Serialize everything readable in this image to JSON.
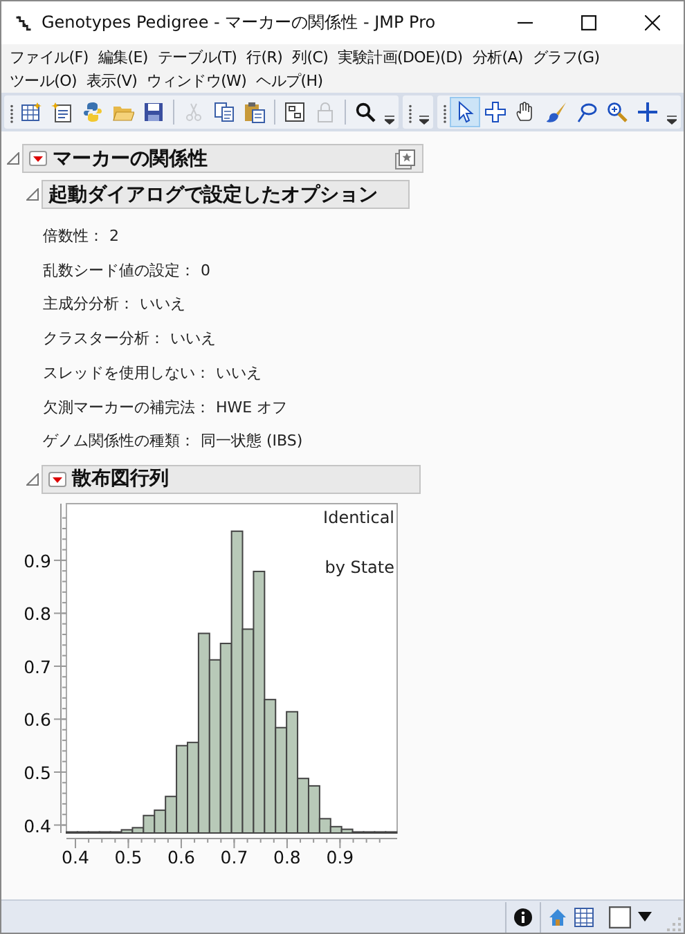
{
  "window": {
    "title": "Genotypes Pedigree - マーカーの関係性 - JMP Pro"
  },
  "menu": [
    "ファイル(F)",
    "編集(E)",
    "テーブル(T)",
    "行(R)",
    "列(C)",
    "実験計画(DOE)(D)",
    "分析(A)",
    "グラフ(G)",
    "ツール(O)",
    "表示(V)",
    "ウィンドウ(W)",
    "ヘルプ(H)"
  ],
  "toolbar": {
    "file_tools": [
      {
        "kind": "new-table",
        "disabled": false
      },
      {
        "kind": "new-script",
        "disabled": false
      },
      {
        "kind": "python",
        "disabled": false
      },
      {
        "kind": "open",
        "disabled": false
      },
      {
        "kind": "save",
        "disabled": false
      },
      {
        "kind": "cut",
        "disabled": true
      },
      {
        "kind": "copy",
        "disabled": false
      },
      {
        "kind": "paste",
        "disabled": false
      },
      {
        "kind": "journal",
        "disabled": false
      },
      {
        "kind": "lock",
        "disabled": true
      },
      {
        "kind": "search",
        "disabled": false
      }
    ],
    "mode_tools": [
      {
        "kind": "arrow",
        "selected": true
      },
      {
        "kind": "crosshair",
        "selected": false
      },
      {
        "kind": "hand",
        "selected": false
      },
      {
        "kind": "brush",
        "selected": false
      },
      {
        "kind": "lasso",
        "selected": false
      },
      {
        "kind": "magnifier",
        "selected": false
      },
      {
        "kind": "plus",
        "selected": false
      }
    ]
  },
  "report": {
    "title": "マーカーの関係性",
    "expanded": true,
    "sections": [
      {
        "title": "起動ダイアログで設定したオプション",
        "expanded": true,
        "has_menu": false,
        "options": [
          {
            "label": "倍数性：",
            "value": "2"
          },
          {
            "label": "乱数シード値の設定：",
            "value": "0"
          },
          {
            "label": "主成分分析：",
            "value": "いいえ"
          },
          {
            "label": "クラスター分析：",
            "value": "いいえ"
          },
          {
            "label": "スレッドを使用しない：",
            "value": "いいえ"
          },
          {
            "label": "欠測マーカーの補完法：",
            "value": "HWE オフ"
          },
          {
            "label": "ゲノム関係性の種類：",
            "value": "同一状態 (IBS)"
          }
        ]
      },
      {
        "title": "散布図行列",
        "expanded": true,
        "has_menu": true,
        "chart_data": {
          "type": "bar",
          "x": [
            0.3934,
            0.4142,
            0.435,
            0.4558,
            0.4766,
            0.4974,
            0.5182,
            0.539,
            0.5598,
            0.5806,
            0.6014,
            0.6222,
            0.643,
            0.6638,
            0.6846,
            0.7054,
            0.7262,
            0.747,
            0.7678,
            0.7886,
            0.8094,
            0.8302,
            0.851,
            0.8718,
            0.8926,
            0.9134,
            0.9342,
            0.955,
            0.9758,
            0.9966
          ],
          "values": [
            0.387,
            0.387,
            0.387,
            0.387,
            0.387,
            0.391,
            0.395,
            0.418,
            0.428,
            0.454,
            0.55,
            0.556,
            0.762,
            0.712,
            0.743,
            0.955,
            0.77,
            0.879,
            0.637,
            0.584,
            0.614,
            0.488,
            0.474,
            0.412,
            0.397,
            0.392,
            0.387,
            0.387,
            0.387,
            0.387
          ],
          "xlim": [
            0.383,
            1.008
          ],
          "ylim": [
            0.385,
            1.007
          ],
          "xticks": [
            0.4,
            0.5,
            0.6,
            0.7,
            0.8,
            0.9
          ],
          "yticks": [
            0.4,
            0.5,
            0.6,
            0.7,
            0.8,
            0.9
          ],
          "annotations": [
            "Identical",
            "by State"
          ]
        }
      }
    ]
  }
}
